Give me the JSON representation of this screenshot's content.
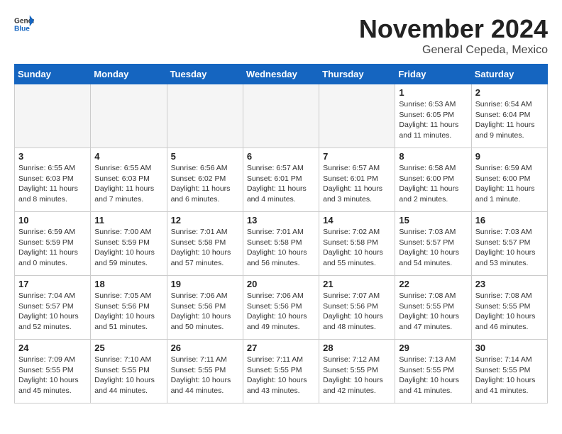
{
  "logo": {
    "general": "General",
    "blue": "Blue"
  },
  "header": {
    "title": "November 2024",
    "subtitle": "General Cepeda, Mexico"
  },
  "weekdays": [
    "Sunday",
    "Monday",
    "Tuesday",
    "Wednesday",
    "Thursday",
    "Friday",
    "Saturday"
  ],
  "weeks": [
    [
      {
        "day": "",
        "info": ""
      },
      {
        "day": "",
        "info": ""
      },
      {
        "day": "",
        "info": ""
      },
      {
        "day": "",
        "info": ""
      },
      {
        "day": "",
        "info": ""
      },
      {
        "day": "1",
        "info": "Sunrise: 6:53 AM\nSunset: 6:05 PM\nDaylight: 11 hours and 11 minutes."
      },
      {
        "day": "2",
        "info": "Sunrise: 6:54 AM\nSunset: 6:04 PM\nDaylight: 11 hours and 9 minutes."
      }
    ],
    [
      {
        "day": "3",
        "info": "Sunrise: 6:55 AM\nSunset: 6:03 PM\nDaylight: 11 hours and 8 minutes."
      },
      {
        "day": "4",
        "info": "Sunrise: 6:55 AM\nSunset: 6:03 PM\nDaylight: 11 hours and 7 minutes."
      },
      {
        "day": "5",
        "info": "Sunrise: 6:56 AM\nSunset: 6:02 PM\nDaylight: 11 hours and 6 minutes."
      },
      {
        "day": "6",
        "info": "Sunrise: 6:57 AM\nSunset: 6:01 PM\nDaylight: 11 hours and 4 minutes."
      },
      {
        "day": "7",
        "info": "Sunrise: 6:57 AM\nSunset: 6:01 PM\nDaylight: 11 hours and 3 minutes."
      },
      {
        "day": "8",
        "info": "Sunrise: 6:58 AM\nSunset: 6:00 PM\nDaylight: 11 hours and 2 minutes."
      },
      {
        "day": "9",
        "info": "Sunrise: 6:59 AM\nSunset: 6:00 PM\nDaylight: 11 hours and 1 minute."
      }
    ],
    [
      {
        "day": "10",
        "info": "Sunrise: 6:59 AM\nSunset: 5:59 PM\nDaylight: 11 hours and 0 minutes."
      },
      {
        "day": "11",
        "info": "Sunrise: 7:00 AM\nSunset: 5:59 PM\nDaylight: 10 hours and 59 minutes."
      },
      {
        "day": "12",
        "info": "Sunrise: 7:01 AM\nSunset: 5:58 PM\nDaylight: 10 hours and 57 minutes."
      },
      {
        "day": "13",
        "info": "Sunrise: 7:01 AM\nSunset: 5:58 PM\nDaylight: 10 hours and 56 minutes."
      },
      {
        "day": "14",
        "info": "Sunrise: 7:02 AM\nSunset: 5:58 PM\nDaylight: 10 hours and 55 minutes."
      },
      {
        "day": "15",
        "info": "Sunrise: 7:03 AM\nSunset: 5:57 PM\nDaylight: 10 hours and 54 minutes."
      },
      {
        "day": "16",
        "info": "Sunrise: 7:03 AM\nSunset: 5:57 PM\nDaylight: 10 hours and 53 minutes."
      }
    ],
    [
      {
        "day": "17",
        "info": "Sunrise: 7:04 AM\nSunset: 5:57 PM\nDaylight: 10 hours and 52 minutes."
      },
      {
        "day": "18",
        "info": "Sunrise: 7:05 AM\nSunset: 5:56 PM\nDaylight: 10 hours and 51 minutes."
      },
      {
        "day": "19",
        "info": "Sunrise: 7:06 AM\nSunset: 5:56 PM\nDaylight: 10 hours and 50 minutes."
      },
      {
        "day": "20",
        "info": "Sunrise: 7:06 AM\nSunset: 5:56 PM\nDaylight: 10 hours and 49 minutes."
      },
      {
        "day": "21",
        "info": "Sunrise: 7:07 AM\nSunset: 5:56 PM\nDaylight: 10 hours and 48 minutes."
      },
      {
        "day": "22",
        "info": "Sunrise: 7:08 AM\nSunset: 5:55 PM\nDaylight: 10 hours and 47 minutes."
      },
      {
        "day": "23",
        "info": "Sunrise: 7:08 AM\nSunset: 5:55 PM\nDaylight: 10 hours and 46 minutes."
      }
    ],
    [
      {
        "day": "24",
        "info": "Sunrise: 7:09 AM\nSunset: 5:55 PM\nDaylight: 10 hours and 45 minutes."
      },
      {
        "day": "25",
        "info": "Sunrise: 7:10 AM\nSunset: 5:55 PM\nDaylight: 10 hours and 44 minutes."
      },
      {
        "day": "26",
        "info": "Sunrise: 7:11 AM\nSunset: 5:55 PM\nDaylight: 10 hours and 44 minutes."
      },
      {
        "day": "27",
        "info": "Sunrise: 7:11 AM\nSunset: 5:55 PM\nDaylight: 10 hours and 43 minutes."
      },
      {
        "day": "28",
        "info": "Sunrise: 7:12 AM\nSunset: 5:55 PM\nDaylight: 10 hours and 42 minutes."
      },
      {
        "day": "29",
        "info": "Sunrise: 7:13 AM\nSunset: 5:55 PM\nDaylight: 10 hours and 41 minutes."
      },
      {
        "day": "30",
        "info": "Sunrise: 7:14 AM\nSunset: 5:55 PM\nDaylight: 10 hours and 41 minutes."
      }
    ]
  ]
}
